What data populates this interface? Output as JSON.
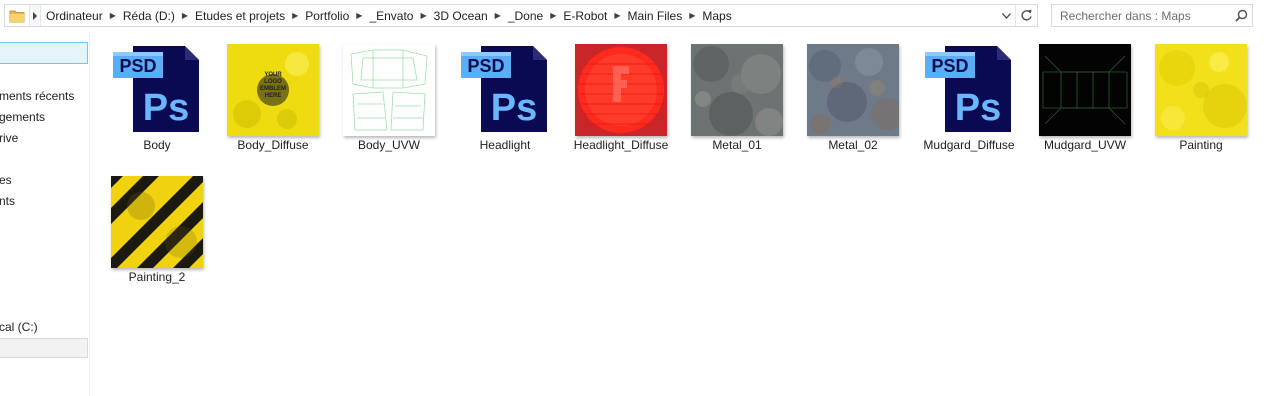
{
  "address_bar": {
    "crumbs": [
      "Ordinateur",
      "Réda (D:)",
      "Etudes et projets",
      "Portfolio",
      "_Envato",
      "3D Ocean",
      "_Done",
      "E-Robot",
      "Main Files",
      "Maps"
    ]
  },
  "search": {
    "placeholder": "Rechercher dans : Maps"
  },
  "nav": {
    "items": [
      "ments récents",
      "gements",
      "rive",
      "es",
      "nts",
      "cal (C:)"
    ]
  },
  "files": [
    {
      "name": "Body",
      "kind": "psd"
    },
    {
      "name": "Body_Diffuse",
      "kind": "yellow-logo"
    },
    {
      "name": "Body_UVW",
      "kind": "uvw-light"
    },
    {
      "name": "Headlight",
      "kind": "psd"
    },
    {
      "name": "Headlight_Diffuse",
      "kind": "red-circle"
    },
    {
      "name": "Metal_01",
      "kind": "metal-gray"
    },
    {
      "name": "Metal_02",
      "kind": "metal-blue"
    },
    {
      "name": "Mudgard_Diffuse",
      "kind": "psd"
    },
    {
      "name": "Mudgard_UVW",
      "kind": "uvw-dark"
    },
    {
      "name": "Painting",
      "kind": "yellow"
    },
    {
      "name": "Painting_2",
      "kind": "hazard-stripes"
    }
  ],
  "psd_icon": {
    "badge": "PSD",
    "letters": "Ps",
    "colors": {
      "dark": "#0a0a52",
      "accent": "#4fa8f5"
    }
  },
  "logo_text": [
    "YOUR",
    "LOGO",
    "EMBLEM",
    "HERE"
  ],
  "colors": {
    "selection_bg": "#e5f3fb",
    "selection_border": "#7ac4ec",
    "texture_yellow": "#f2e01a",
    "headlight_red": "#e8231b"
  }
}
